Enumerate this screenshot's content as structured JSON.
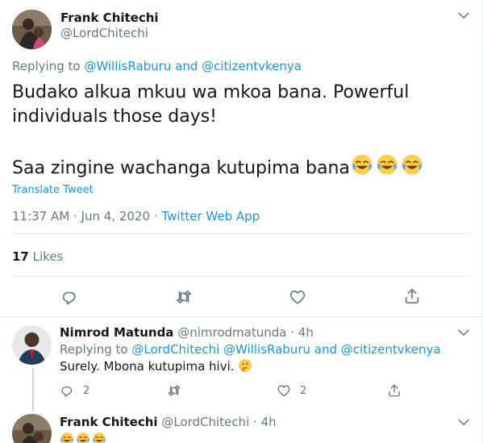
{
  "main_tweet": {
    "name": "Frank Chitechi",
    "handle": "@LordChitechi",
    "replying_prefix": "Replying to",
    "replying_user1": "@WillisRaburu",
    "replying_and": "and",
    "replying_user2": "@citizentvkenya",
    "text_line1": "Budako alkua mkuu wa mkoa bana. Powerful",
    "text_line2": "individuals those days!",
    "text_line3": "Saa zingine wachanga kutupima bana",
    "emoji_line3": [
      "tears-of-joy",
      "tears-of-joy",
      "tears-of-joy"
    ],
    "translate": "Translate Tweet",
    "time": "11:37 AM",
    "date": "Jun 4, 2020",
    "source": "Twitter Web App",
    "sep": "·",
    "likes_count": "17",
    "likes_label": "Likes"
  },
  "reply1": {
    "name": "Nimrod Matunda",
    "handle": "@nimrodmatunda",
    "sep": "·",
    "time": "4h",
    "replying_prefix": "Replying to",
    "replying_user1": "@LordChitechi",
    "replying_user2": "@WillisRaburu",
    "replying_and": "and",
    "replying_user3": "@citizentvkenya",
    "text": "Surely. Mbona kutupima hivi.",
    "emoji": "thinking-face",
    "reply_count": "2",
    "like_count": "2"
  },
  "reply2": {
    "name": "Frank Chitechi",
    "handle": "@LordChitechi",
    "sep": "·",
    "time": "4h",
    "emoji": [
      "tears-of-joy",
      "tears-of-joy",
      "tears-of-joy"
    ]
  },
  "colors": {
    "accent": "#1b95e0",
    "muted": "#657786",
    "text": "#14171a",
    "border": "#e6ecf0",
    "emoji_yellow": "#ffcc4d"
  }
}
